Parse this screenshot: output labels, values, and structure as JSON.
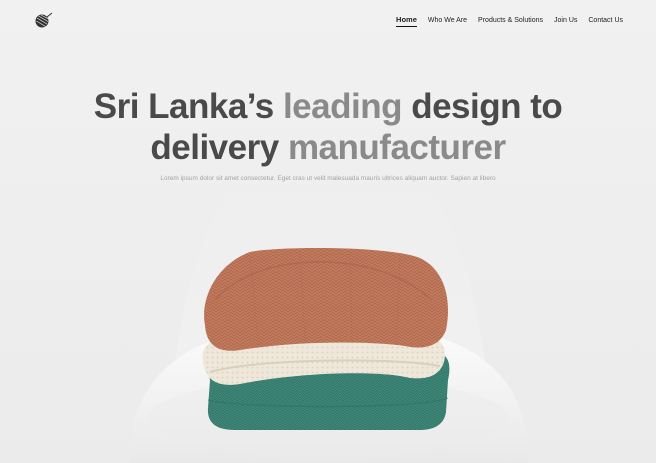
{
  "header": {
    "logo_icon": "yarn-ball-icon",
    "nav": [
      {
        "label": "Home",
        "active": true
      },
      {
        "label": "Who We Are",
        "active": false
      },
      {
        "label": "Products & Solutions",
        "active": false
      },
      {
        "label": "Join Us",
        "active": false
      },
      {
        "label": "Contact Us",
        "active": false
      }
    ]
  },
  "hero": {
    "title_line1_dark": "Sri Lanka’s",
    "title_line1_light": "leading",
    "title_line1_end": "design to",
    "title_line2_start": "delivery",
    "title_line2_light": "manufacturer",
    "subtitle": "Lorem ipsum dolor sit amet consectetur. Eget cras ut velit malesuada mauris ultrices aliquam auctor. Sapien at libero"
  },
  "colors": {
    "background": "#efefef",
    "sweater_top": "#c07a5c",
    "sweater_middle": "#efe9dc",
    "sweater_bottom": "#3f8a7a",
    "chair": "#f7f7f7"
  }
}
